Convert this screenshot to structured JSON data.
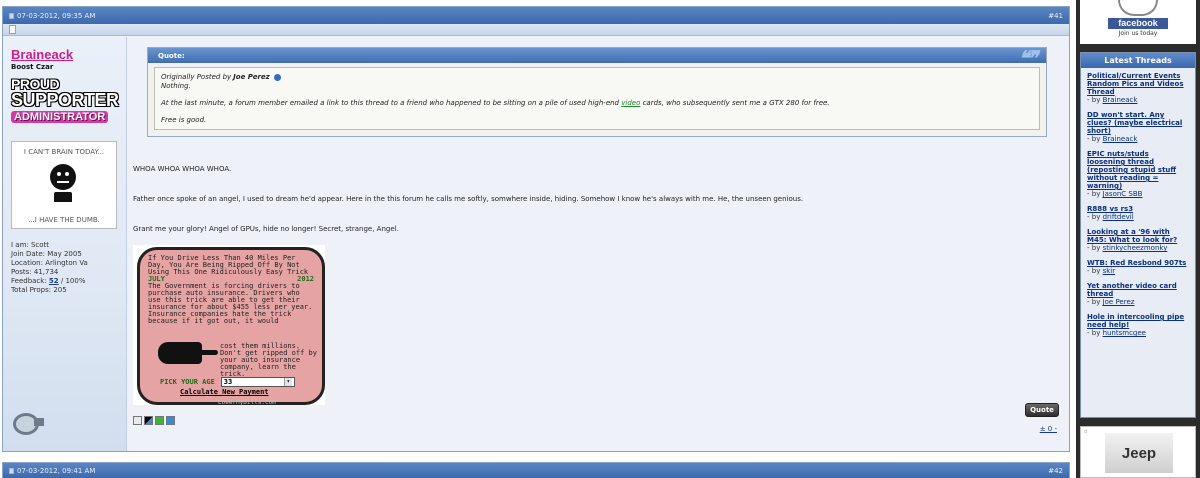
{
  "post41": {
    "date": "07-03-2012, 09:35 AM",
    "index": "#41",
    "user": {
      "name": "Braineack",
      "title": "Boost Czar",
      "badge_line1": "PROUD",
      "badge_line2": "SUPPORTER",
      "badge_line3": "ADMINISTRATOR",
      "avatar_top": "I CAN'T BRAIN TODAY...",
      "avatar_bottom": "...I HAVE THE DUMB.",
      "info": {
        "iam": "I am: Scott",
        "join": "Join Date: May 2005",
        "location": "Location: Arlington Va",
        "posts": "Posts: 41,734",
        "feedback_label": "Feedback: ",
        "feedback_count": "52",
        "feedback_pct": " / 100%",
        "props": "Total Props: 205"
      }
    },
    "quote": {
      "label": "Quote:",
      "originally": "Originally Posted by",
      "author": "Joe Perez",
      "line1": "Nothing.",
      "line2_a": "At the last minute, a forum member emailed a link to this thread to a friend who happened to be sitting on a pile of used high-end ",
      "line2_link": "video",
      "line2_b": " cards, who subsequently sent me a GTX 280 for free.",
      "line3": "Free is good."
    },
    "body": {
      "p1": "WHOA WHOA WHOA WHOA.",
      "p2": "Father once spoke of an angel, I used to dream he'd appear. Here in the this forum he calls me softly, somwhere inside, hiding. Somehow I know he's always with me. He, the unseen genious.",
      "p3": "Grant me your glory! Angel of GPUs, hide no longer! Secret, strange, Angel."
    },
    "ad": {
      "headline": "If You Drive Less Than 40 Miles Per Day, You Are Being Ripped Off By Not Using This One Ridiculously Easy Trick",
      "month": "JULY",
      "year": "2012",
      "body_top": "The Government is forcing drivers to purchase auto insurance. Drivers who use this trick are able to get their insurance for about $455 less per year. Insurance companies hate the trick because if it got out, it would",
      "body_side": "cost them millions. Don't get ripped off by your auto insurance company, learn the trick.",
      "age_label": "PICK YOUR AGE",
      "age_value": "33",
      "cta": "Calculate New Payment",
      "footer": "LowerMyBills.com"
    },
    "quote_button": "Quote",
    "votes": "± 0 -"
  },
  "post42": {
    "date": "07-03-2012, 09:41 AM",
    "index": "#42"
  },
  "sidebar": {
    "facebook_label": "facebook",
    "facebook_sub": "Join us today",
    "latest_title": "Latest Threads",
    "threads": [
      {
        "title": "Political/Current Events Random Pics and Videos Thread",
        "by": "- by ",
        "author": "Braineack"
      },
      {
        "title": "DD won't start. Any clues? (maybe electrical short)",
        "by": "- by ",
        "author": "Braineack"
      },
      {
        "title": "EPIC nuts/studs loosening thread (reposting stupid stuff without reading = warning)",
        "by": "- by ",
        "author": "JasonC SBB"
      },
      {
        "title": "R888 vs rs3",
        "by": "- by ",
        "author": "driftdevil"
      },
      {
        "title": "Looking at a '96 with M45: What to look for?",
        "by": "- by ",
        "author": "stinkycheezmonky"
      },
      {
        "title": "WTB: Red Resbond 907ts",
        "by": "- by ",
        "author": "skir"
      },
      {
        "title": "Yet another video card thread",
        "by": "- by ",
        "author": "Joe Perez"
      },
      {
        "title": "Hole in intercooling pipe need help!",
        "by": "- by ",
        "author": "huntsmcgee"
      }
    ],
    "jeep_ad": "Jeep",
    "jeep_marker": "d"
  }
}
